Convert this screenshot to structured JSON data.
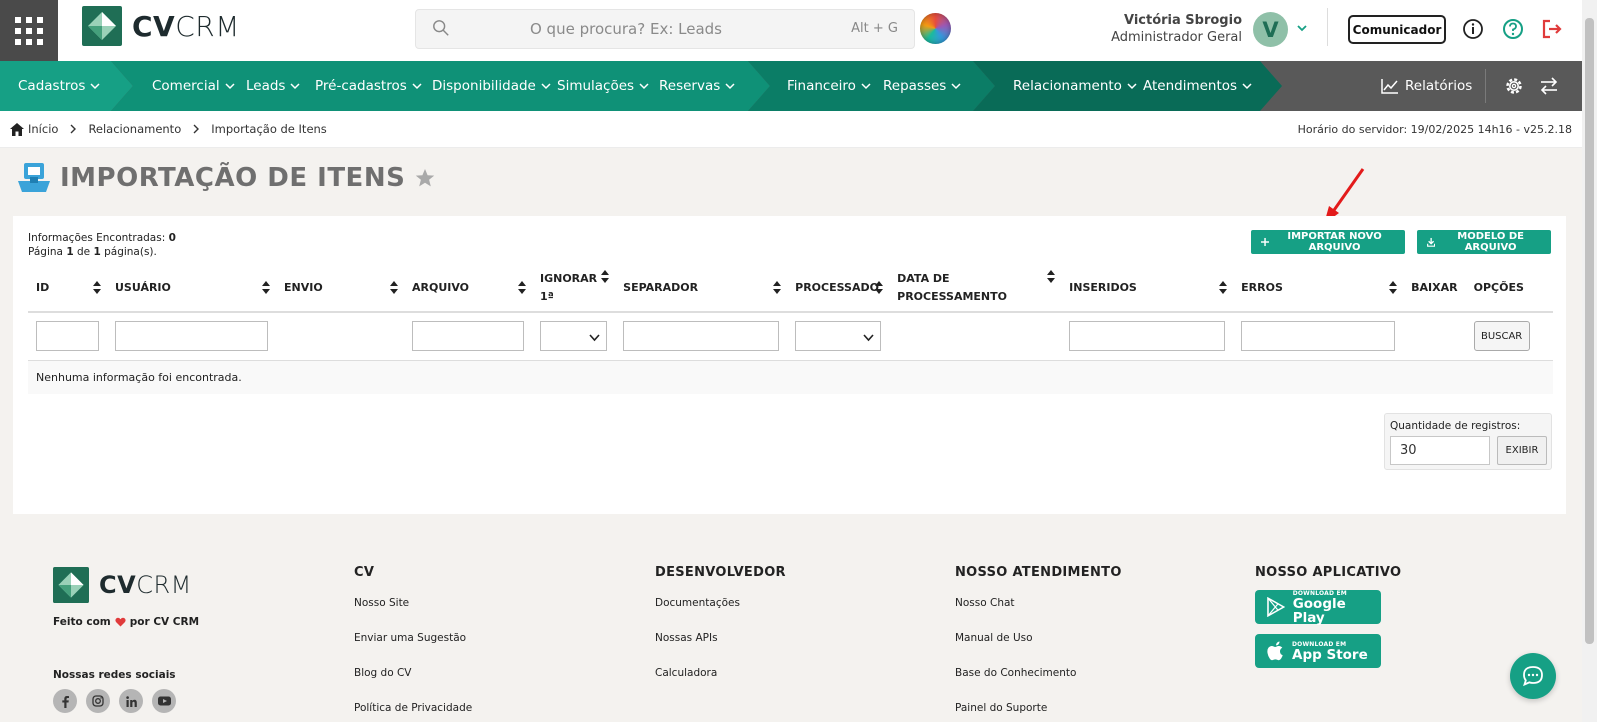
{
  "header": {
    "brand_bold": "CV",
    "brand_light": "CRM",
    "search_placeholder": "O que procura? Ex: Leads",
    "search_shortcut": "Alt + G",
    "user_name": "Victória Sbrogio",
    "user_role": "Administrador Geral",
    "avatar_initial": "V",
    "comunicador_label": "Comunicador"
  },
  "nav": {
    "items": [
      {
        "label": "Cadastros"
      },
      {
        "label": "Comercial"
      },
      {
        "label": "Leads"
      },
      {
        "label": "Pré-cadastros"
      },
      {
        "label": "Disponibilidade"
      },
      {
        "label": "Simulações"
      },
      {
        "label": "Reservas"
      },
      {
        "label": "Financeiro"
      },
      {
        "label": "Repasses"
      },
      {
        "label": "Relacionamento"
      },
      {
        "label": "Atendimentos"
      }
    ],
    "reports_label": "Relatórios",
    "colors": {
      "seg1": "#16a085",
      "seg2": "#0e8f75",
      "seg3": "#0b7a63",
      "seg4": "#096a56",
      "rest": "#595959"
    }
  },
  "breadcrumb": {
    "home": "Início",
    "level1": "Relacionamento",
    "level2": "Importação de Itens",
    "server_time": "Horário do servidor: 19/02/2025 14h16 - v25.2.18"
  },
  "page": {
    "title": "IMPORTAÇÃO DE ITENS"
  },
  "results": {
    "found_label": "Informações Encontradas:",
    "found_count": "0",
    "page_label_1": "Página",
    "page_current": "1",
    "page_label_2": "de",
    "page_total": "1",
    "page_label_3": "página(s)."
  },
  "actions": {
    "import_label": "IMPORTAR NOVO ARQUIVO",
    "model_label": "MODELO DE ARQUIVO"
  },
  "table": {
    "columns": [
      "ID",
      "USUÁRIO",
      "ENVIO",
      "ARQUIVO",
      "IGNORAR 1ª",
      "SEPARADOR",
      "PROCESSADO",
      "DATA DE PROCESSAMENTO",
      "INSERIDOS",
      "ERROS",
      "BAIXAR",
      "OPÇÕES"
    ],
    "search_label": "BUSCAR",
    "empty_message": "Nenhuma informação foi encontrada."
  },
  "pagination": {
    "qty_label": "Quantidade de registros:",
    "qty_value": "30",
    "show_label": "EXIBIR"
  },
  "footer": {
    "made_prefix": "Feito com",
    "made_suffix": "por CV CRM",
    "social_title": "Nossas redes sociais",
    "columns": [
      {
        "title": "CV",
        "links": [
          "Nosso Site",
          "Enviar uma Sugestão",
          "Blog do CV",
          "Política de Privacidade"
        ]
      },
      {
        "title": "DESENVOLVEDOR",
        "links": [
          "Documentações",
          "Nossas APIs",
          "Calculadora"
        ]
      },
      {
        "title": "NOSSO ATENDIMENTO",
        "links": [
          "Nosso Chat",
          "Manual de Uso",
          "Base do Conhecimento",
          "Painel do Suporte"
        ]
      }
    ],
    "app_title": "NOSSO APLICATIVO",
    "google_small": "DOWNLOAD EM",
    "google_big": "Google Play",
    "apple_small": "DOWNLOAD EM",
    "apple_big": "App Store"
  },
  "icons": {
    "apps": "apps-grid-icon",
    "search": "search-icon",
    "info": "info-icon",
    "help": "help-icon",
    "logout": "logout-icon",
    "reports": "chart-line-icon",
    "settings": "gear-icon",
    "switch": "swap-arrows-icon",
    "favorite": "star-icon",
    "chat": "chat-bubble-icon"
  },
  "colors": {
    "accent": "#16a085",
    "danger": "#e03b3b"
  }
}
